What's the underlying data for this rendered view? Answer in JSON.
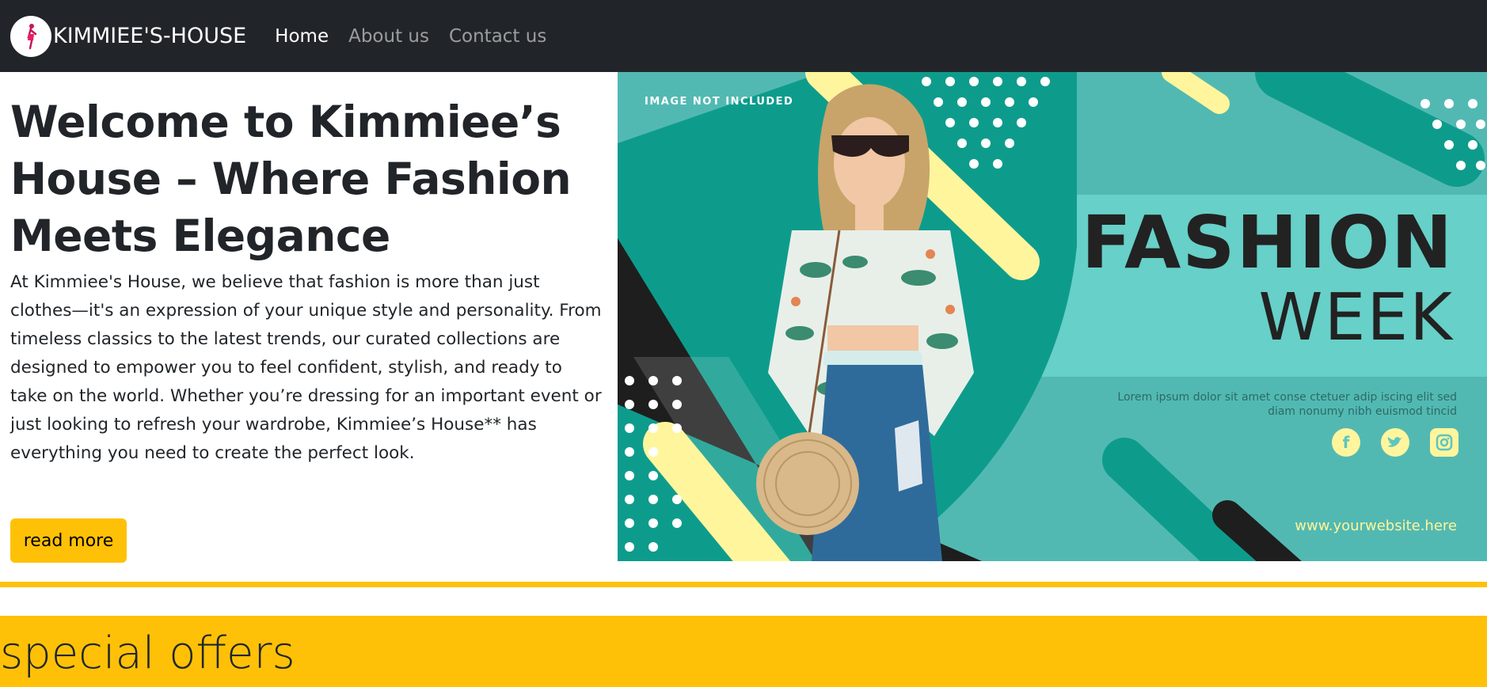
{
  "navbar": {
    "brand": "KIMMIEE'S-HOUSE",
    "links": [
      {
        "label": "Home"
      },
      {
        "label": "About us"
      },
      {
        "label": "Contact us"
      }
    ]
  },
  "hero": {
    "title": "Welcome to Kimmiee’s House – Where Fashion Meets Elegance",
    "description": "At Kimmiee's House, we believe that fashion is more than just clothes—it's an expression of your unique style and personality. From timeless classics to the latest trends, our curated collections are designed to empower you to feel confident, stylish, and ready to take on the world. Whether you’re dressing for an important event or just looking to refresh your wardrobe, Kimmiee’s House** has everything you need to create the perfect look.",
    "button_label": "read more"
  },
  "banner": {
    "label": "IMAGE NOT INCLUDED",
    "headline_1": "FASHION",
    "headline_2": "WEEK",
    "lorem": "Lorem ipsum dolor sit amet conse ctetuer adip iscing elit sed diam nonumy nibh euismod tincid",
    "website": "www.yourwebsite.here",
    "social_icons": [
      "facebook-icon",
      "twitter-icon",
      "instagram-icon"
    ]
  },
  "offers": {
    "title": "special offers"
  },
  "colors": {
    "navbar_bg": "#212529",
    "accent_yellow": "#ffc107",
    "banner_teal": "#5cc6c0"
  }
}
